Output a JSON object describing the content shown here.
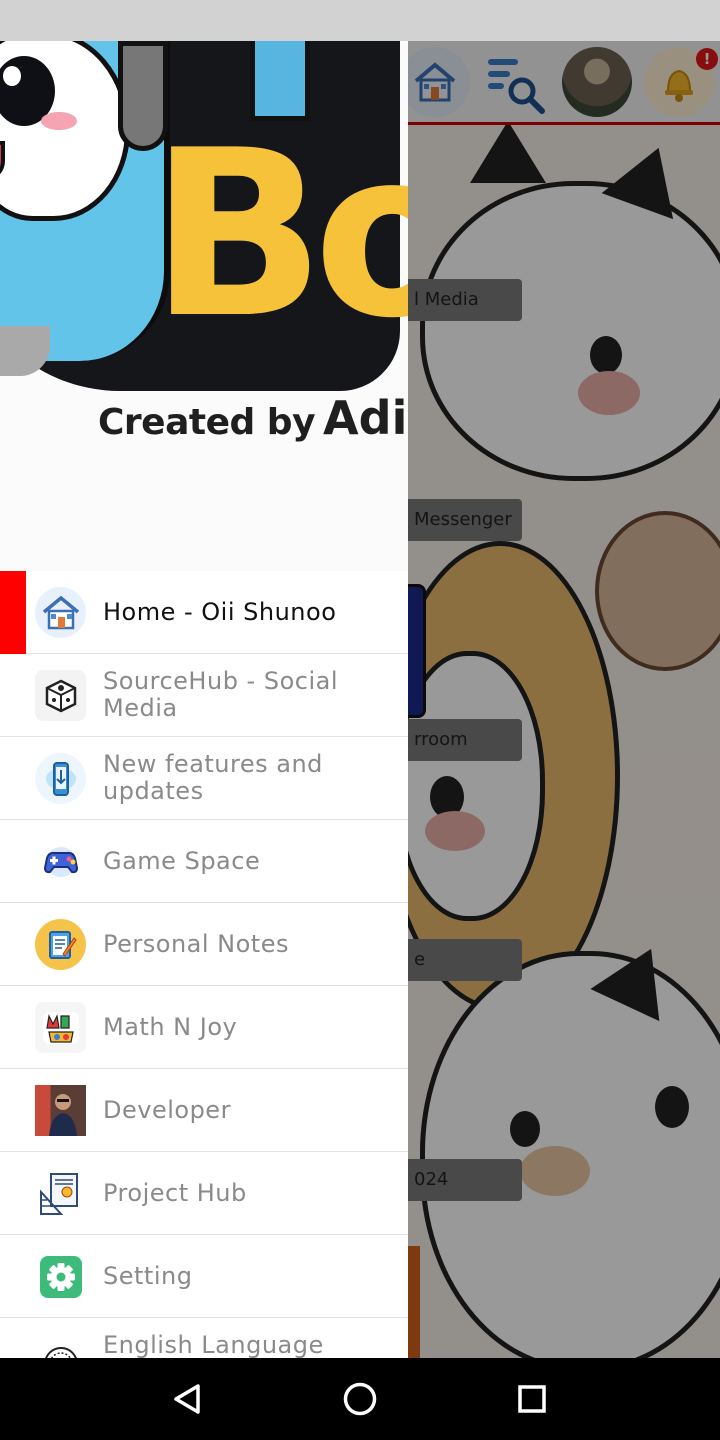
{
  "drawer": {
    "header": {
      "logo_text": "Bo",
      "created_by_text": "Created by",
      "created_by_name": "Adi"
    },
    "menu": [
      {
        "label": "Home - Oii Shunoo",
        "icon": "home-icon",
        "active": true
      },
      {
        "label": "SourceHub - Social Media",
        "icon": "sourcehub-cube-icon",
        "active": false
      },
      {
        "label": "New features and updates",
        "icon": "phone-download-icon",
        "active": false
      },
      {
        "label": "Game Space",
        "icon": "gamepad-icon",
        "active": false
      },
      {
        "label": "Personal Notes",
        "icon": "notepad-icon",
        "active": false
      },
      {
        "label": "Math N Joy",
        "icon": "math-n-joy-icon",
        "active": false
      },
      {
        "label": "Developer",
        "icon": "developer-photo-icon",
        "active": false
      },
      {
        "label": "Project Hub",
        "icon": "blueprint-icon",
        "active": false
      },
      {
        "label": "Setting",
        "icon": "gear-icon",
        "active": false
      },
      {
        "label": "English Language Club",
        "icon": "seal-icon",
        "active": false
      }
    ]
  },
  "background": {
    "toolbar_icons": [
      "home-icon",
      "search-list-icon",
      "profile-avatar",
      "bell-icon"
    ],
    "notification_badge": "!",
    "chips": [
      "l Media",
      "Messenger",
      "rroom",
      "e",
      "024"
    ]
  },
  "colors": {
    "active_indicator": "#ff0000",
    "toolbar_border": "#d00000",
    "active_label": "#111111",
    "inactive_label": "#8a8a8a"
  }
}
